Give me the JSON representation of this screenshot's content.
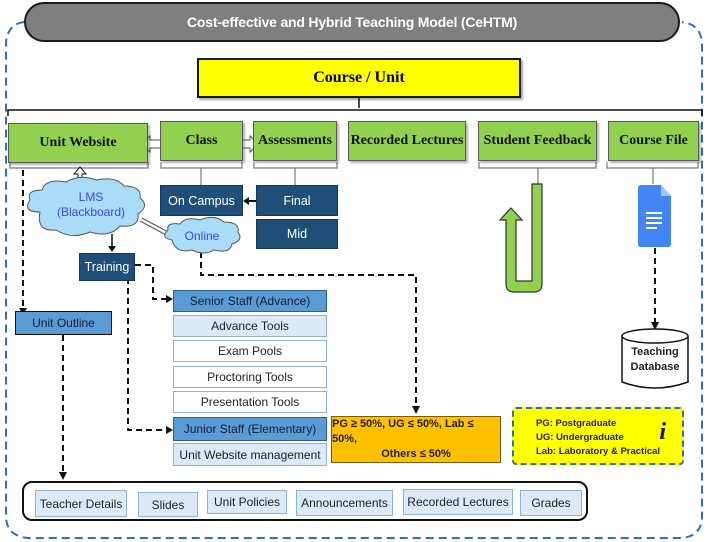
{
  "title": "Cost-effective and Hybrid Teaching Model (CeHTM)",
  "root": "Course / Unit",
  "components": [
    {
      "label": "Unit Website"
    },
    {
      "label": "Class"
    },
    {
      "label": "Assessments"
    },
    {
      "label": "Recorded Lectures"
    },
    {
      "label": "Student Feedback"
    },
    {
      "label": "Course File"
    }
  ],
  "class_modes": {
    "on_campus": "On Campus",
    "online": "Online"
  },
  "assessments": {
    "final": "Final",
    "mid": "Mid"
  },
  "lms": {
    "line1": "LMS",
    "line2": "(Blackboard)"
  },
  "training": "Training",
  "unit_outline": "Unit Outline",
  "senior_staff": {
    "label": "Senior Staff (Advance)",
    "items": [
      "Advance Tools",
      "Exam Pools",
      "Proctoring Tools",
      "Presentation Tools"
    ]
  },
  "junior_staff": {
    "label": "Junior Staff (Elementary)",
    "items": [
      "Unit Website management"
    ]
  },
  "ratio_box": {
    "line1": "PG ≥ 50%,  UG ≤  50%, Lab ≤ 50%,",
    "line2": "Others ≤ 50%"
  },
  "legend": {
    "entries": [
      "PG: Postgraduate",
      "UG: Undergraduate",
      "Lab: Laboratory & Practical"
    ],
    "icon": "i"
  },
  "database": {
    "line1": "Teaching",
    "line2": "Database"
  },
  "unit_website_sections": [
    "Teacher Details",
    "Slides",
    "Unit Policies",
    "Announcements",
    "Recorded Lectures",
    "Grades"
  ],
  "colors": {
    "title_bg": "#7f7f7f",
    "root_bg": "#ffff00",
    "component_bg": "#92d050",
    "navy": "#1f4e79",
    "mid_blue": "#5b9bd5",
    "pale_blue": "#dce9f6",
    "cloud": "#a9dcf7",
    "orange": "#ffc000",
    "outline_dash": "#2e6fb5",
    "doc_icon": "#4285f4"
  }
}
